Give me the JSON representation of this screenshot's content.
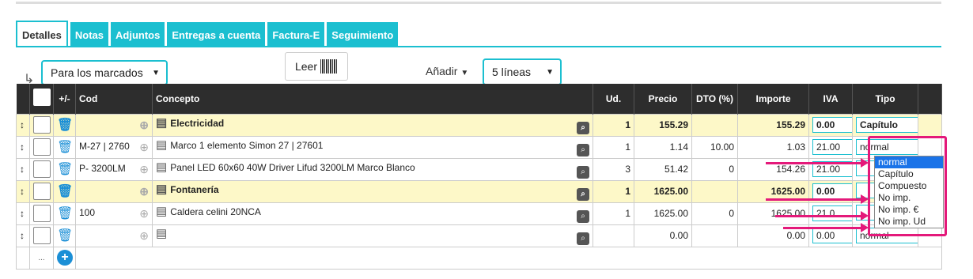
{
  "tabs": [
    "Detalles",
    "Notas",
    "Adjuntos",
    "Entregas a cuenta",
    "Factura-E",
    "Seguimiento"
  ],
  "bulk_select": "Para los marcados",
  "leer_label": "Leer",
  "anadir_label": "Añadir",
  "lines_select": "5 líneas",
  "headers": {
    "cod": "Cod",
    "concepto": "Concepto",
    "ud": "Ud.",
    "precio": "Precio",
    "dto": "DTO (%)",
    "importe": "Importe",
    "iva": "IVA",
    "tipo": "Tipo"
  },
  "rows": [
    {
      "cod": "",
      "concepto": "Electricidad",
      "ud": "1",
      "precio": "155.29",
      "dto": "",
      "importe": "155.29",
      "iva": "0.00",
      "tipo": "Capítulo"
    },
    {
      "cod": "M-27 | 2760",
      "concepto": "Marco 1 elemento Simon 27 | 27601",
      "ud": "1",
      "precio": "1.14",
      "dto": "10.00",
      "importe": "1.03",
      "iva": "21.00",
      "tipo": "normal"
    },
    {
      "cod": "P- 3200LM",
      "concepto": "Panel LED 60x60 40W Driver Lifud 3200LM Marco Blanco",
      "ud": "3",
      "precio": "51.42",
      "dto": "0",
      "importe": "154.26",
      "iva": "21.00",
      "tipo": ""
    },
    {
      "cod": "",
      "concepto": "Fontanería",
      "ud": "1",
      "precio": "1625.00",
      "dto": "",
      "importe": "1625.00",
      "iva": "0.00",
      "tipo": ""
    },
    {
      "cod": "100",
      "concepto": "Caldera celini 20NCA",
      "ud": "1",
      "precio": "1625.00",
      "dto": "0",
      "importe": "1625.00",
      "iva": "21.0",
      "tipo": ""
    },
    {
      "cod": "",
      "concepto": "",
      "ud": "",
      "precio": "0.00",
      "dto": "",
      "importe": "0.00",
      "iva": "0.00",
      "tipo": "normal"
    }
  ],
  "dropdown_options": [
    "normal",
    "Capítulo",
    "Compuesto",
    "No imp.",
    "No imp. €",
    "No imp. Ud"
  ],
  "footer_dots": "...",
  "colors": {
    "accent": "#1bbfd0",
    "chapter_row": "#fdf8c8",
    "highlight": "#e4197a",
    "header": "#2d2d2d"
  }
}
